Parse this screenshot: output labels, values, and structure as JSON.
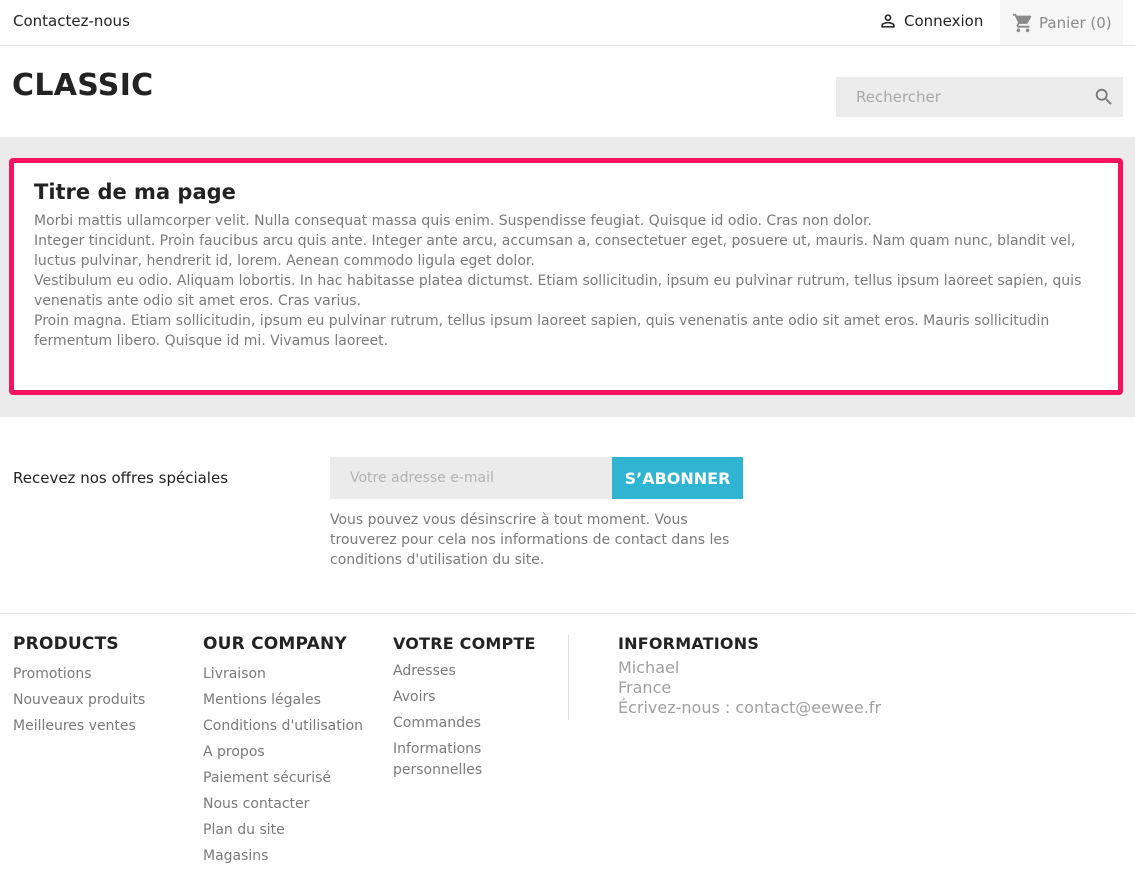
{
  "topnav": {
    "contact": "Contactez-nous",
    "login": "Connexion",
    "cart": "Panier (0)"
  },
  "header": {
    "logo": "CLASSIC",
    "search_placeholder": "Rechercher"
  },
  "cms": {
    "title": "Titre de ma page",
    "paragraphs": [
      "Morbi mattis ullamcorper velit. Nulla consequat massa quis enim. Suspendisse feugiat. Quisque id odio. Cras non dolor.",
      "Integer tincidunt. Proin faucibus arcu quis ante. Integer ante arcu, accumsan a, consectetuer eget, posuere ut, mauris. Nam quam nunc, blandit vel, luctus pulvinar, hendrerit id, lorem. Aenean commodo ligula eget dolor.",
      "Vestibulum eu odio. Aliquam lobortis. In hac habitasse platea dictumst. Etiam sollicitudin, ipsum eu pulvinar rutrum, tellus ipsum laoreet sapien, quis venenatis ante odio sit amet eros. Cras varius.",
      "Proin magna. Etiam sollicitudin, ipsum eu pulvinar rutrum, tellus ipsum laoreet sapien, quis venenatis ante odio sit amet eros. Mauris sollicitudin fermentum libero. Quisque id mi. Vivamus laoreet."
    ]
  },
  "newsletter": {
    "label": "Recevez nos offres spéciales",
    "placeholder": "Votre adresse e-mail",
    "button": "S’ABONNER",
    "note": "Vous pouvez vous désinscrire à tout moment. Vous trouverez pour cela nos informations de contact dans les conditions d'utilisation du site."
  },
  "footer": {
    "products": {
      "title": "PRODUCTS",
      "links": [
        "Promotions",
        "Nouveaux produits",
        "Meilleures ventes"
      ]
    },
    "company": {
      "title": "OUR COMPANY",
      "links": [
        "Livraison",
        "Mentions légales",
        "Conditions d'utilisation",
        "A propos",
        "Paiement sécurisé",
        "Nous contacter",
        "Plan du site",
        "Magasins"
      ]
    },
    "account": {
      "title": "VOTRE COMPTE",
      "links": [
        "Adresses",
        "Avoirs",
        "Commandes",
        "Informations personnelles"
      ]
    },
    "info": {
      "title": "INFORMATIONS",
      "name": "Michael",
      "country": "France",
      "email": "Écrivez-nous : contact@eewee.fr"
    }
  },
  "colors": {
    "accent": "#2fb5d2",
    "highlight_border": "#f4135c"
  }
}
